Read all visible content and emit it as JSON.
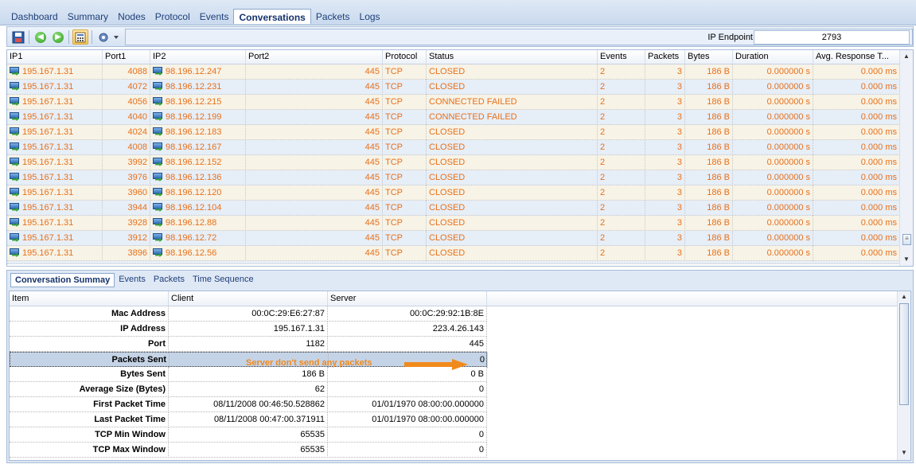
{
  "menu": {
    "tabs": [
      "Dashboard",
      "Summary",
      "Nodes",
      "Protocol",
      "Events",
      "Conversations",
      "Packets",
      "Logs"
    ],
    "active": "Conversations"
  },
  "toolbar": {
    "ip_endpoint_label": "IP Endpoint",
    "ip_endpoint_value": "2793",
    "icons": [
      "save-icon",
      "back-icon",
      "forward-icon",
      "calculator-icon",
      "network-settings-icon"
    ]
  },
  "grid": {
    "headers": [
      "IP1",
      "Port1",
      "IP2",
      "Port2",
      "Protocol",
      "Status",
      "Events",
      "Packets",
      "Bytes",
      "Duration",
      "Avg. Response T..."
    ],
    "rows": [
      [
        "195.167.1.31",
        "4088",
        "98.196.12.247",
        "445",
        "TCP",
        "CLOSED",
        "2",
        "3",
        "186 B",
        "0.000000 s",
        "0.000 ms"
      ],
      [
        "195.167.1.31",
        "4072",
        "98.196.12.231",
        "445",
        "TCP",
        "CLOSED",
        "2",
        "3",
        "186 B",
        "0.000000 s",
        "0.000 ms"
      ],
      [
        "195.167.1.31",
        "4056",
        "98.196.12.215",
        "445",
        "TCP",
        "CONNECTED FAILED",
        "2",
        "3",
        "186 B",
        "0.000000 s",
        "0.000 ms"
      ],
      [
        "195.167.1.31",
        "4040",
        "98.196.12.199",
        "445",
        "TCP",
        "CONNECTED FAILED",
        "2",
        "3",
        "186 B",
        "0.000000 s",
        "0.000 ms"
      ],
      [
        "195.167.1.31",
        "4024",
        "98.196.12.183",
        "445",
        "TCP",
        "CLOSED",
        "2",
        "3",
        "186 B",
        "0.000000 s",
        "0.000 ms"
      ],
      [
        "195.167.1.31",
        "4008",
        "98.196.12.167",
        "445",
        "TCP",
        "CLOSED",
        "2",
        "3",
        "186 B",
        "0.000000 s",
        "0.000 ms"
      ],
      [
        "195.167.1.31",
        "3992",
        "98.196.12.152",
        "445",
        "TCP",
        "CLOSED",
        "2",
        "3",
        "186 B",
        "0.000000 s",
        "0.000 ms"
      ],
      [
        "195.167.1.31",
        "3976",
        "98.196.12.136",
        "445",
        "TCP",
        "CLOSED",
        "2",
        "3",
        "186 B",
        "0.000000 s",
        "0.000 ms"
      ],
      [
        "195.167.1.31",
        "3960",
        "98.196.12.120",
        "445",
        "TCP",
        "CLOSED",
        "2",
        "3",
        "186 B",
        "0.000000 s",
        "0.000 ms"
      ],
      [
        "195.167.1.31",
        "3944",
        "98.196.12.104",
        "445",
        "TCP",
        "CLOSED",
        "2",
        "3",
        "186 B",
        "0.000000 s",
        "0.000 ms"
      ],
      [
        "195.167.1.31",
        "3928",
        "98.196.12.88",
        "445",
        "TCP",
        "CLOSED",
        "2",
        "3",
        "186 B",
        "0.000000 s",
        "0.000 ms"
      ],
      [
        "195.167.1.31",
        "3912",
        "98.196.12.72",
        "445",
        "TCP",
        "CLOSED",
        "2",
        "3",
        "186 B",
        "0.000000 s",
        "0.000 ms"
      ],
      [
        "195.167.1.31",
        "3896",
        "98.196.12.56",
        "445",
        "TCP",
        "CLOSED",
        "2",
        "3",
        "186 B",
        "0.000000 s",
        "0.000 ms"
      ]
    ],
    "text_color": "#e8701a"
  },
  "detail": {
    "tabs": [
      "Conversation Summay",
      "Events",
      "Packets",
      "Time Sequence"
    ],
    "active": "Conversation Summay",
    "headers": [
      "Item",
      "Client",
      "Server"
    ],
    "rows": [
      [
        "Mac Address",
        "00:0C:29:E6:27:87",
        "00:0C:29:92:1B:8E"
      ],
      [
        "IP Address",
        "195.167.1.31",
        "223.4.26.143"
      ],
      [
        "Port",
        "1182",
        "445"
      ],
      [
        "Packets Sent",
        "",
        "0"
      ],
      [
        "Bytes Sent",
        "186 B",
        "0 B"
      ],
      [
        "Average Size (Bytes)",
        "62",
        "0"
      ],
      [
        "First Packet Time",
        "08/11/2008 00:46:50.528862",
        "01/01/1970 08:00:00.000000"
      ],
      [
        "Last Packet Time",
        "08/11/2008 00:47:00.371911",
        "01/01/1970 08:00:00.000000"
      ],
      [
        "TCP Min Window",
        "65535",
        "0"
      ],
      [
        "TCP Max Window",
        "65535",
        "0"
      ]
    ],
    "selected_row": 3,
    "annotation": "Server don't send any packets",
    "annotation_color": "#f08a1c"
  }
}
